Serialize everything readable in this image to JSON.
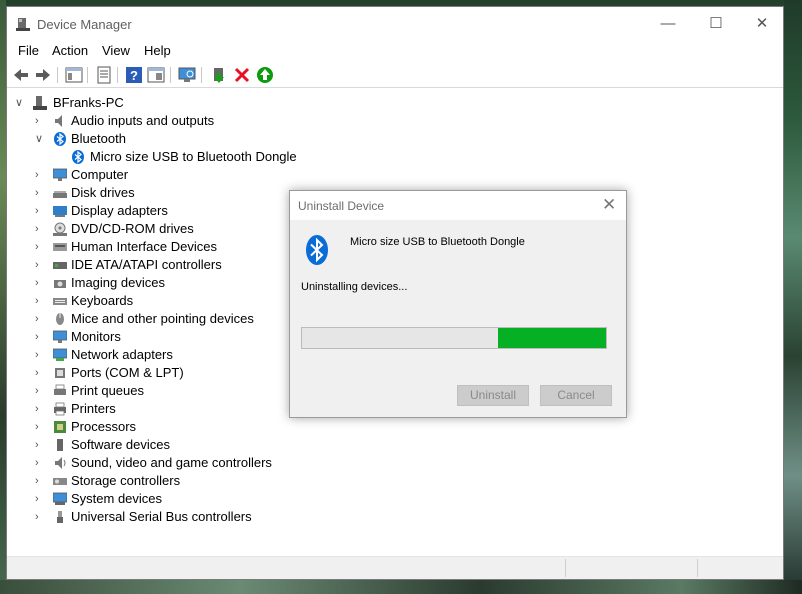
{
  "window": {
    "title": "Device Manager",
    "icon": "device-manager-icon"
  },
  "titlebar_buttons": [
    "minimize-icon",
    "maximize-icon",
    "close-icon"
  ],
  "menu": [
    "File",
    "Action",
    "View",
    "Help"
  ],
  "toolbar": [
    "back-arrow-icon",
    "forward-arrow-icon",
    "console-tree-icon",
    "properties-icon",
    "help-icon",
    "show-hide-icon",
    "scan-hardware-icon",
    "update-driver-icon",
    "uninstall-x-icon",
    "enable-device-icon"
  ],
  "tree": {
    "root": "BFranks-PC",
    "categories": [
      {
        "label": "Audio inputs and outputs",
        "icon": "speaker-icon",
        "expanded": false
      },
      {
        "label": "Bluetooth",
        "icon": "bluetooth-icon",
        "expanded": true,
        "children": [
          "Micro size USB to Bluetooth Dongle"
        ]
      },
      {
        "label": "Computer",
        "icon": "monitor-icon",
        "expanded": false
      },
      {
        "label": "Disk drives",
        "icon": "disk-icon",
        "expanded": false
      },
      {
        "label": "Display adapters",
        "icon": "display-adapter-icon",
        "expanded": false
      },
      {
        "label": "DVD/CD-ROM drives",
        "icon": "optical-drive-icon",
        "expanded": false
      },
      {
        "label": "Human Interface Devices",
        "icon": "hid-icon",
        "expanded": false
      },
      {
        "label": "IDE ATA/ATAPI controllers",
        "icon": "ide-controller-icon",
        "expanded": false
      },
      {
        "label": "Imaging devices",
        "icon": "camera-icon",
        "expanded": false
      },
      {
        "label": "Keyboards",
        "icon": "keyboard-icon",
        "expanded": false
      },
      {
        "label": "Mice and other pointing devices",
        "icon": "mouse-icon",
        "expanded": false
      },
      {
        "label": "Monitors",
        "icon": "monitor-icon",
        "expanded": false
      },
      {
        "label": "Network adapters",
        "icon": "network-icon",
        "expanded": false
      },
      {
        "label": "Ports (COM & LPT)",
        "icon": "port-icon",
        "expanded": false
      },
      {
        "label": "Print queues",
        "icon": "print-queue-icon",
        "expanded": false
      },
      {
        "label": "Printers",
        "icon": "printer-icon",
        "expanded": false
      },
      {
        "label": "Processors",
        "icon": "processor-icon",
        "expanded": false
      },
      {
        "label": "Software devices",
        "icon": "software-device-icon",
        "expanded": false
      },
      {
        "label": "Sound, video and game controllers",
        "icon": "sound-icon",
        "expanded": false
      },
      {
        "label": "Storage controllers",
        "icon": "storage-icon",
        "expanded": false
      },
      {
        "label": "System devices",
        "icon": "system-icon",
        "expanded": false
      },
      {
        "label": "Universal Serial Bus controllers",
        "icon": "usb-icon",
        "expanded": false
      }
    ]
  },
  "dialog": {
    "title": "Uninstall Device",
    "device_name": "Micro size USB to Bluetooth Dongle",
    "status": "Uninstalling devices...",
    "progress": {
      "filled_from": 0.645,
      "filled_to": 1.0
    },
    "buttons": {
      "uninstall": "Uninstall",
      "cancel": "Cancel"
    }
  },
  "colors": {
    "progress_green": "#06b025",
    "bluetooth_blue": "#0a6cd6",
    "toolbar_red": "#e81123",
    "toolbar_green": "#0e9a0e"
  }
}
